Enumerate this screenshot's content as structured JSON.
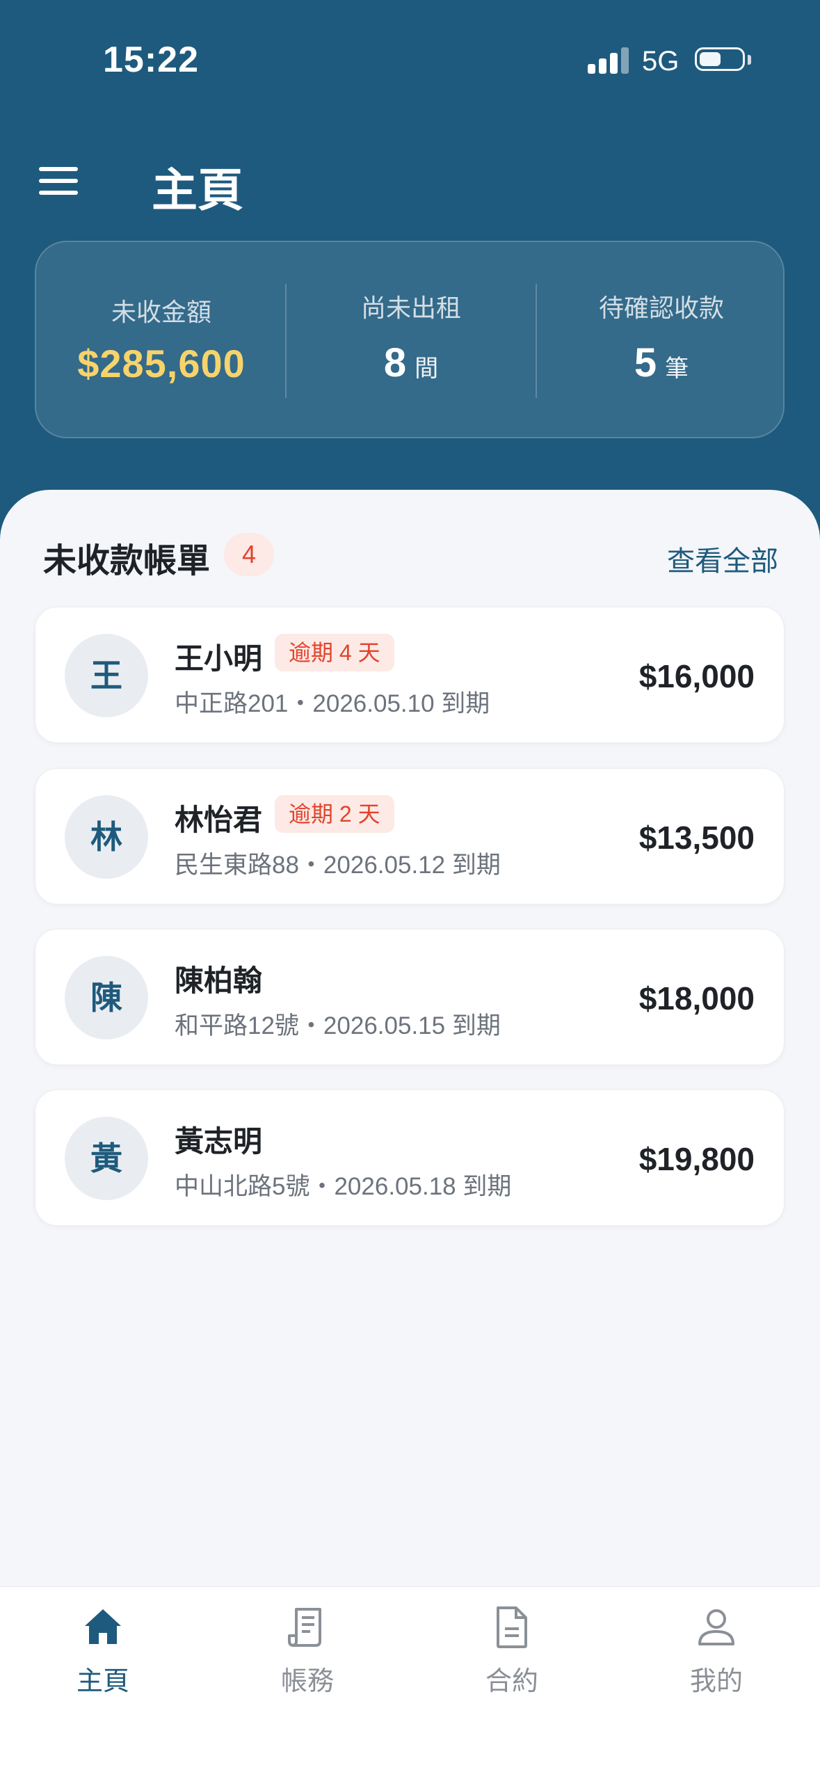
{
  "status_bar": {
    "time": "15:22",
    "network": "5G"
  },
  "header": {
    "title": "主頁"
  },
  "summary": {
    "unpaid_amount": {
      "label": "未收金額",
      "value": "$285,600"
    },
    "vacant": {
      "label": "尚未出租",
      "value": "8",
      "unit": "間"
    },
    "pending": {
      "label": "待確認收款",
      "value": "5",
      "unit": "筆"
    }
  },
  "bills_section": {
    "title": "未收款帳單",
    "count": "4",
    "view_all": "查看全部"
  },
  "bills": [
    {
      "avatar": "王",
      "name": "王小明",
      "overdue": "逾期 4 天",
      "detail": "中正路201・2026.05.10 到期",
      "amount": "$16,000"
    },
    {
      "avatar": "林",
      "name": "林怡君",
      "overdue": "逾期 2 天",
      "detail": "民生東路88・2026.05.12 到期",
      "amount": "$13,500"
    },
    {
      "avatar": "陳",
      "name": "陳柏翰",
      "overdue": "",
      "detail": "和平路12號・2026.05.15 到期",
      "amount": "$18,000"
    },
    {
      "avatar": "黃",
      "name": "黃志明",
      "overdue": "",
      "detail": "中山北路5號・2026.05.18 到期",
      "amount": "$19,800"
    }
  ],
  "tabbar": [
    {
      "label": "主頁",
      "icon": "home-icon",
      "active": true
    },
    {
      "label": "帳務",
      "icon": "receipt-icon",
      "active": false
    },
    {
      "label": "合約",
      "icon": "document-icon",
      "active": false
    },
    {
      "label": "我的",
      "icon": "user-icon",
      "active": false
    }
  ],
  "colors": {
    "header": "#1e5a7d",
    "accent_gold": "#f7d36b",
    "overdue_red": "#e0442c",
    "background": "#f4f6f9"
  }
}
